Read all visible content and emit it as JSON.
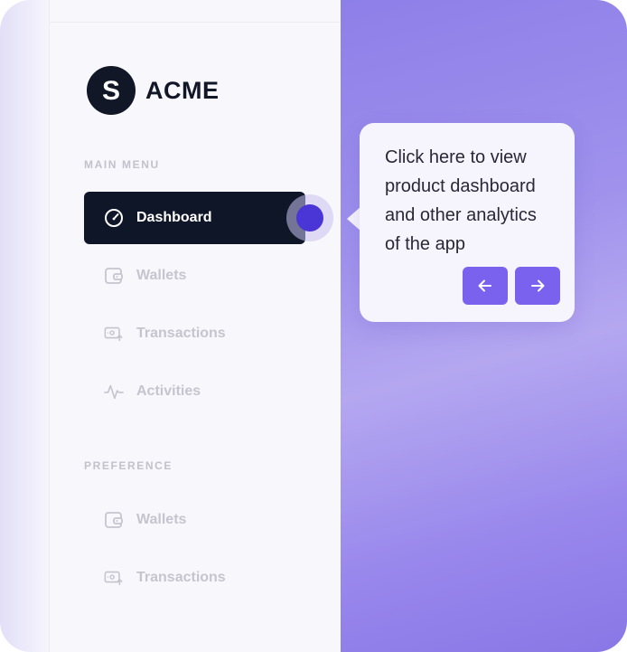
{
  "brand": {
    "initial": "S",
    "name": "ACME"
  },
  "menu": {
    "main_label": "MAIN MENU",
    "main_items": [
      {
        "label": "Dashboard",
        "icon": "gauge-icon",
        "active": true
      },
      {
        "label": "Wallets",
        "icon": "wallet-icon",
        "active": false
      },
      {
        "label": "Transactions",
        "icon": "transactions-icon",
        "active": false
      },
      {
        "label": "Activities",
        "icon": "activity-icon",
        "active": false
      }
    ],
    "preference_label": "PREFERENCE",
    "preference_items": [
      {
        "label": "Wallets",
        "icon": "wallet-icon"
      },
      {
        "label": "Transactions",
        "icon": "transactions-icon"
      }
    ]
  },
  "tooltip": {
    "text": "Click here to view product dashboard and other analytics of the app",
    "prev_icon": "arrow-left-icon",
    "next_icon": "arrow-right-icon"
  },
  "colors": {
    "active_bg": "#0f1628",
    "accent_dot": "#4a36d6",
    "button": "#7a62ee",
    "background_purple": "#9f91ec"
  }
}
